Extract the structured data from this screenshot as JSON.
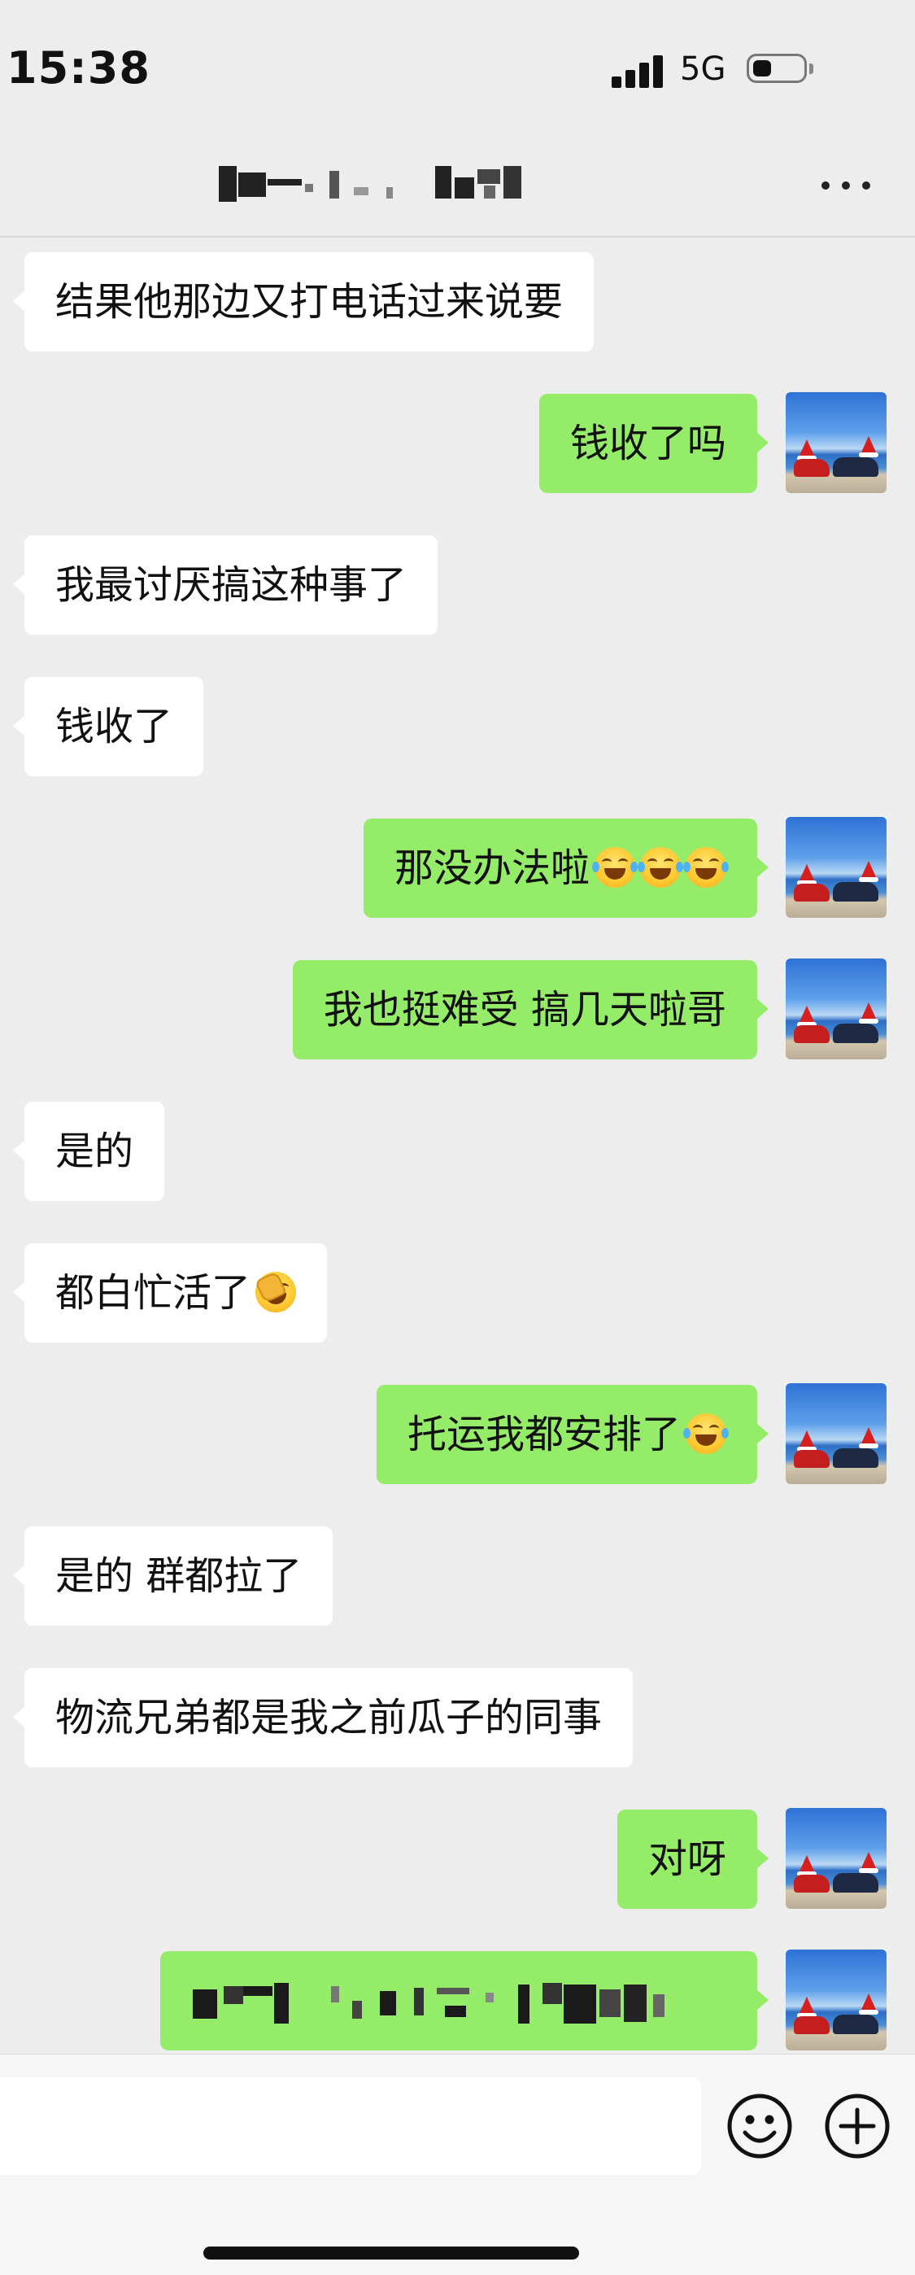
{
  "status_bar": {
    "time": "15:38",
    "network": "5G",
    "icons": [
      "signal-icon",
      "battery-icon"
    ]
  },
  "nav": {
    "title": "",
    "title_obscured": true,
    "more_icon": "more-icon"
  },
  "colors": {
    "background": "#ededed",
    "incoming_bubble": "#ffffff",
    "outgoing_bubble": "#95ec69"
  },
  "messages": [
    {
      "side": "left",
      "text": "结果他那边又打电话过来说要"
    },
    {
      "side": "right",
      "text": "钱收了吗"
    },
    {
      "side": "left",
      "text": "我最讨厌搞这种事了"
    },
    {
      "side": "left",
      "text": "钱收了"
    },
    {
      "side": "right",
      "text": "那没办法啦",
      "emoji": [
        "tears-of-joy-emoji",
        "tears-of-joy-emoji",
        "tears-of-joy-emoji"
      ]
    },
    {
      "side": "right",
      "text": "我也挺难受 搞几天啦哥"
    },
    {
      "side": "left",
      "text": "是的"
    },
    {
      "side": "left",
      "text": "都白忙活了",
      "emoji": [
        "face-palm-emoji"
      ]
    },
    {
      "side": "right",
      "text": "托运我都安排了",
      "emoji": [
        "tears-of-joy-emoji"
      ]
    },
    {
      "side": "left",
      "text": "是的 群都拉了"
    },
    {
      "side": "left",
      "text": "物流兄弟都是我之前瓜子的同事"
    },
    {
      "side": "right",
      "text": "对呀"
    },
    {
      "side": "right",
      "text": "",
      "obscured": true
    }
  ],
  "input_bar": {
    "input_value": "",
    "icons": [
      "emoji-icon",
      "plus-icon"
    ]
  }
}
